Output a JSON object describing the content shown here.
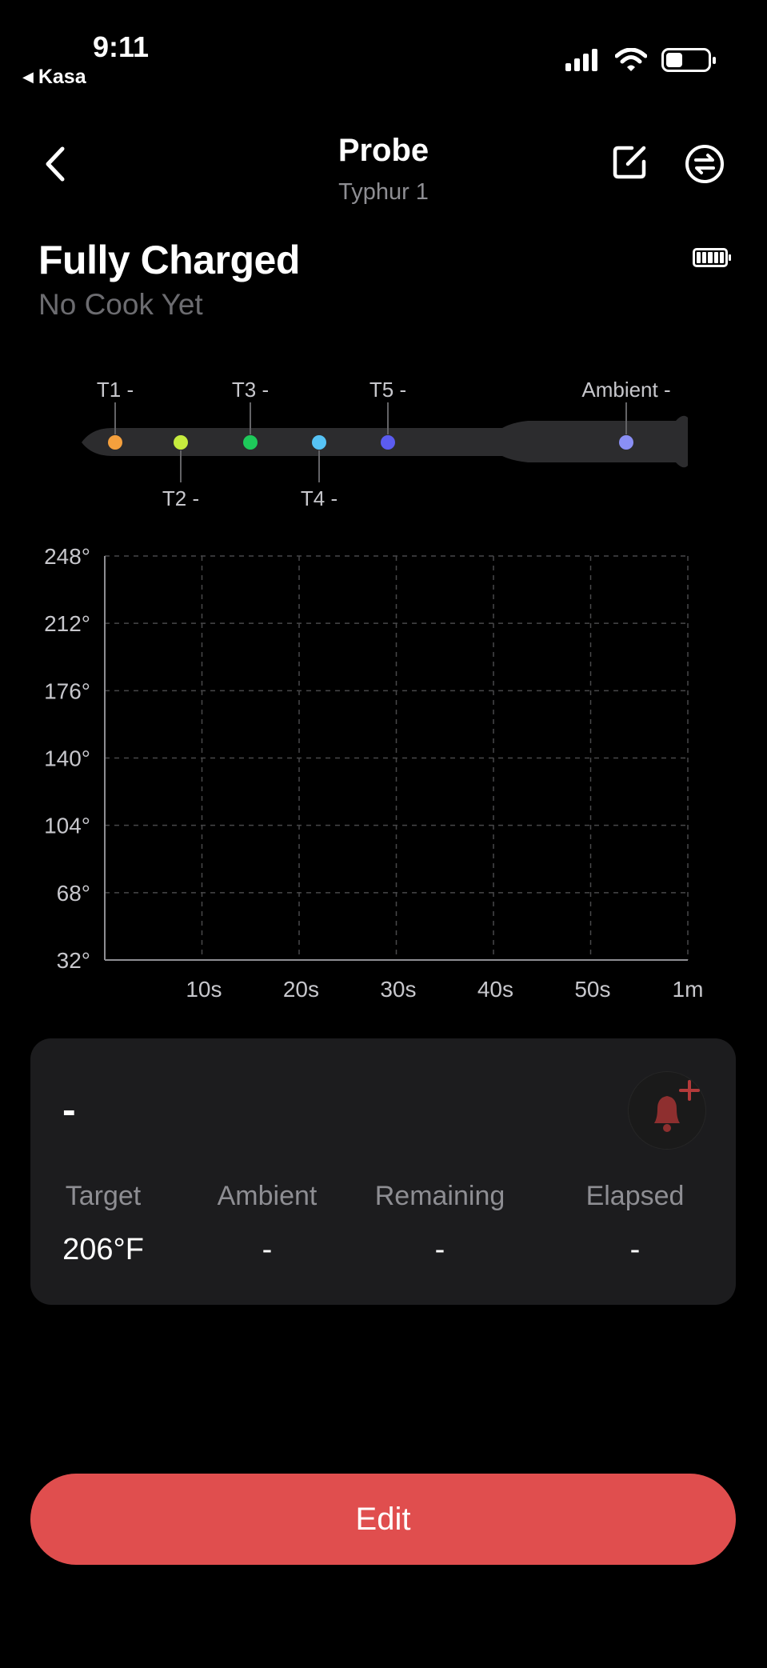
{
  "status_bar": {
    "time": "9:11",
    "back_app": "Kasa"
  },
  "header": {
    "title": "Probe",
    "subtitle": "Typhur 1"
  },
  "charge": {
    "status": "Fully Charged",
    "cook_status": "No Cook Yet"
  },
  "probe": {
    "sensors": [
      {
        "label": "T1",
        "reading": "-",
        "color": "#f5a03d"
      },
      {
        "label": "T2",
        "reading": "-",
        "color": "#c6ec3e"
      },
      {
        "label": "T3",
        "reading": "-",
        "color": "#1ec95a"
      },
      {
        "label": "T4",
        "reading": "-",
        "color": "#56c3f5"
      },
      {
        "label": "T5",
        "reading": "-",
        "color": "#5b5cf0"
      },
      {
        "label": "Ambient",
        "reading": "-",
        "color": "#8a8ff5"
      }
    ]
  },
  "chart_data": {
    "type": "line",
    "title": "",
    "xlabel": "",
    "ylabel": "",
    "y_ticks": [
      "248°",
      "212°",
      "176°",
      "140°",
      "104°",
      "68°",
      "32°"
    ],
    "x_ticks": [
      "10s",
      "20s",
      "30s",
      "40s",
      "50s",
      "1m"
    ],
    "ylim": [
      32,
      248
    ],
    "xlim": [
      0,
      60
    ],
    "grid": true,
    "series": []
  },
  "card": {
    "current_temp": "-",
    "stats": [
      {
        "label": "Target",
        "value": "206°F"
      },
      {
        "label": "Ambient",
        "value": "-"
      },
      {
        "label": "Remaining",
        "value": "-"
      },
      {
        "label": "Elapsed",
        "value": "-"
      }
    ]
  },
  "actions": {
    "edit_label": "Edit"
  },
  "colors": {
    "accent": "#e04e4e",
    "card_bg": "#1c1c1e"
  }
}
